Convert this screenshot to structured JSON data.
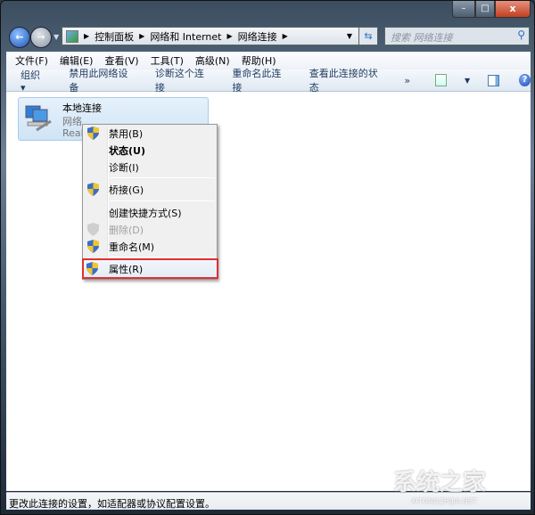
{
  "window": {
    "close_glyph": "x"
  },
  "address": {
    "crumbs": [
      "控制面板",
      "网络和 Internet",
      "网络连接"
    ]
  },
  "search": {
    "placeholder": "搜索 网络连接"
  },
  "menubar": [
    "文件(F)",
    "编辑(E)",
    "查看(V)",
    "工具(T)",
    "高级(N)",
    "帮助(H)"
  ],
  "toolbar": {
    "organize": "组织 ▾",
    "items": [
      "禁用此网络设备",
      "诊断这个连接",
      "重命名此连接",
      "查看此连接的状态"
    ],
    "more": "»"
  },
  "connection": {
    "name": "本地连接",
    "network": "网络",
    "adapter": "Real"
  },
  "context_menu": {
    "items": [
      {
        "label": "禁用(B)",
        "icon": "shield-icon"
      },
      {
        "label": "状态(U)"
      },
      {
        "label": "诊断(I)"
      },
      {
        "label": "桥接(G)",
        "icon": "shield-icon"
      },
      {
        "label": "创建快捷方式(S)"
      },
      {
        "label": "删除(D)",
        "icon": "shield-icon",
        "disabled": true
      },
      {
        "label": "重命名(M)",
        "icon": "shield-icon"
      },
      {
        "label": "属性(R)",
        "icon": "shield-icon",
        "highlighted": true
      }
    ]
  },
  "status_bar": "更改此连接的设置，如适配器或协议配置设置。",
  "watermark": {
    "text": "系统之家",
    "sub": "XITONGZHIJIA.NET"
  },
  "colors": {
    "highlight_box": "#e03030"
  }
}
